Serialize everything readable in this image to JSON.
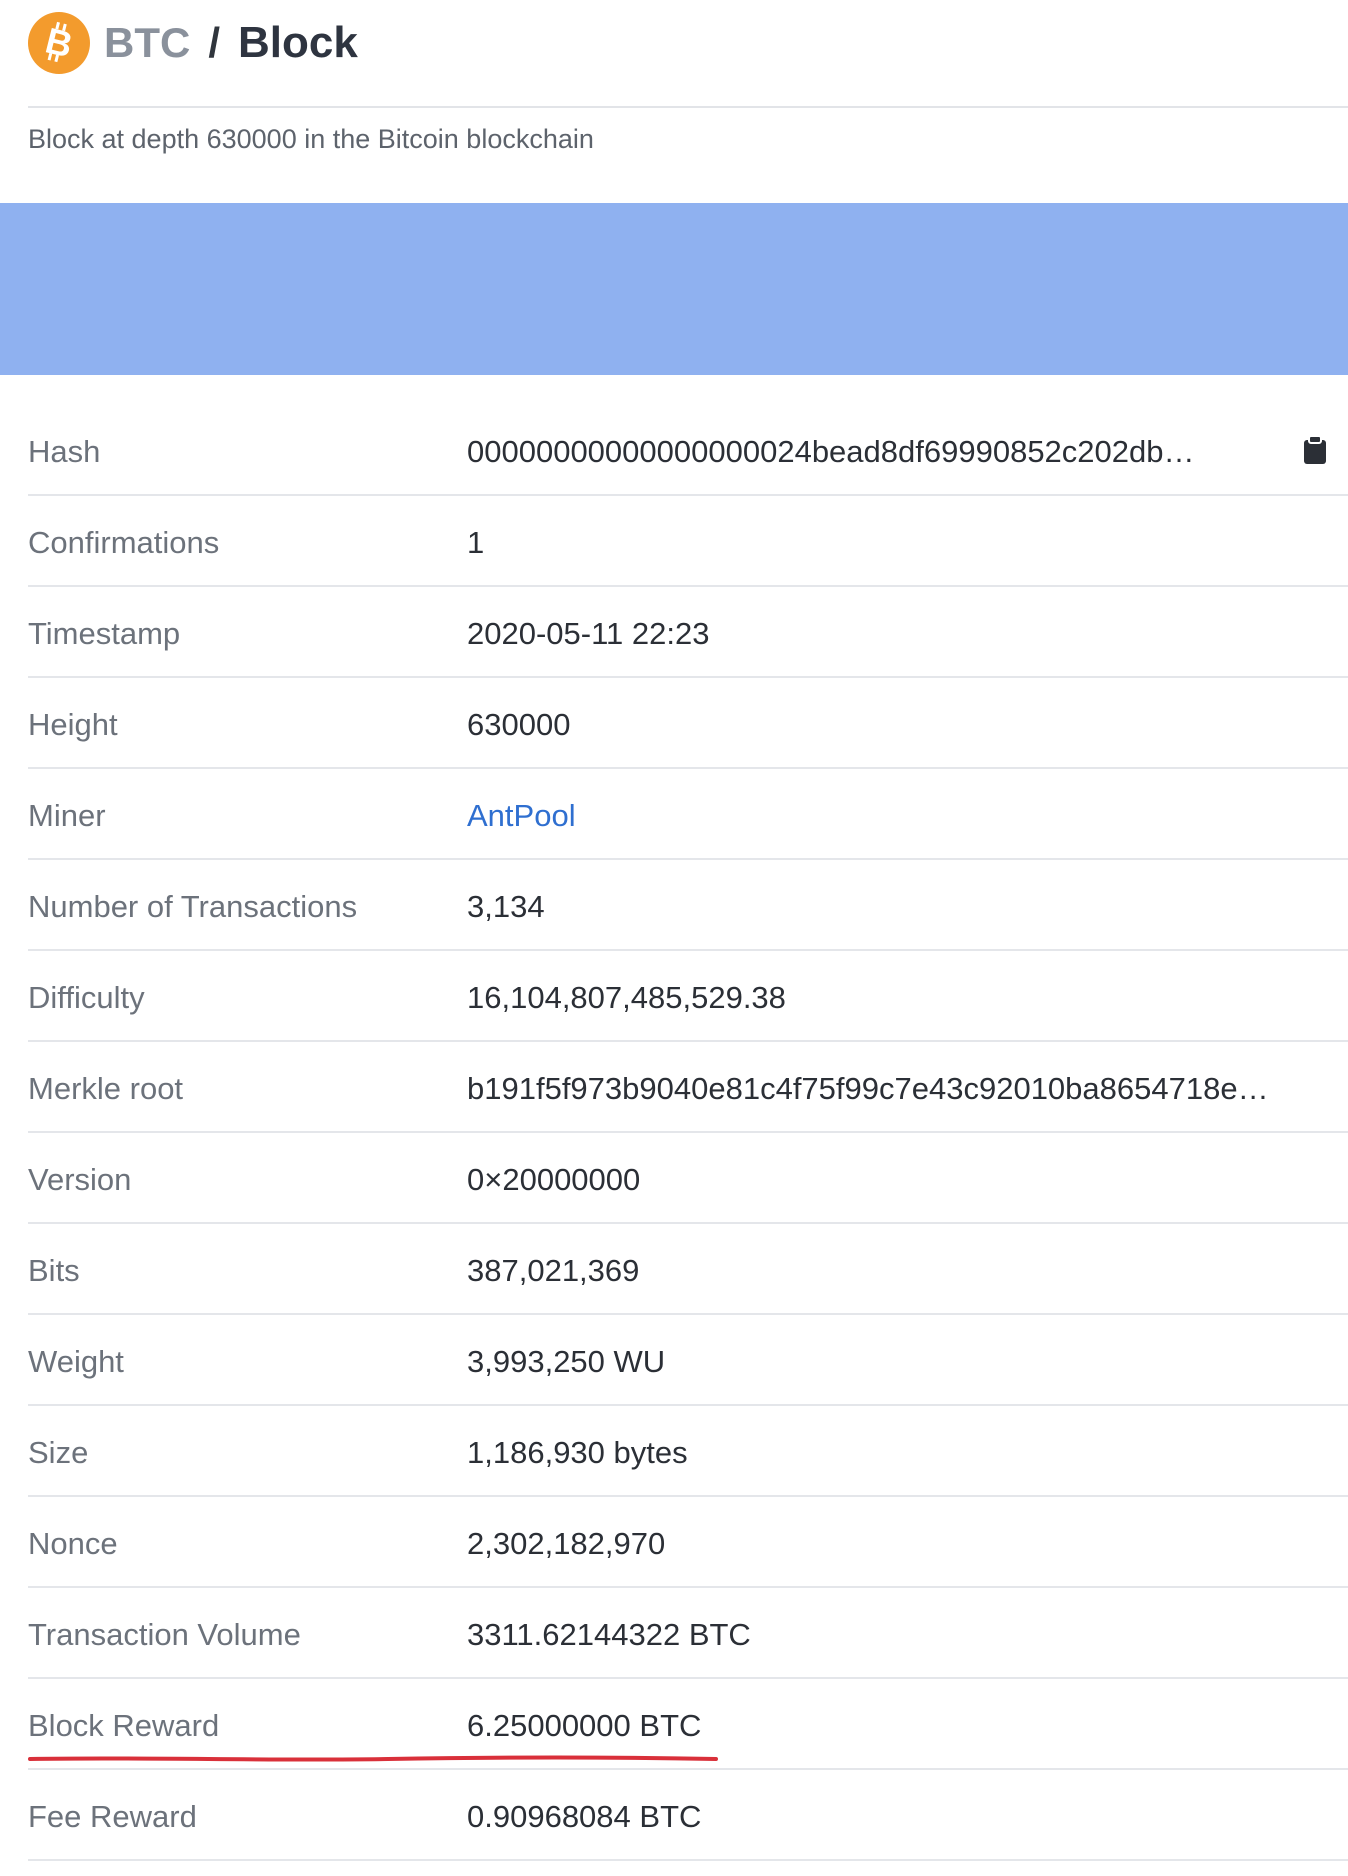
{
  "header": {
    "coin": "BTC",
    "separator": "/",
    "page": "Block",
    "subtitle": "Block at depth 630000 in the Bitcoin blockchain",
    "logo_color": "#f39b2d"
  },
  "banner": {
    "color": "#8fb1f0"
  },
  "details": [
    {
      "label": "Hash",
      "value": "00000000000000000024bead8df69990852c202db…"
    },
    {
      "label": "Confirmations",
      "value": "1"
    },
    {
      "label": "Timestamp",
      "value": "2020-05-11 22:23"
    },
    {
      "label": "Height",
      "value": "630000"
    },
    {
      "label": "Miner",
      "value": "AntPool"
    },
    {
      "label": "Number of Transactions",
      "value": "3,134"
    },
    {
      "label": "Difficulty",
      "value": "16,104,807,485,529.38"
    },
    {
      "label": "Merkle root",
      "value": "b191f5f973b9040e81c4f75f99c7e43c92010ba8654718e…"
    },
    {
      "label": "Version",
      "value": "0×20000000"
    },
    {
      "label": "Bits",
      "value": "387,021,369"
    },
    {
      "label": "Weight",
      "value": "3,993,250 WU"
    },
    {
      "label": "Size",
      "value": "1,186,930 bytes"
    },
    {
      "label": "Nonce",
      "value": "2,302,182,970"
    },
    {
      "label": "Transaction Volume",
      "value": "3311.62144322 BTC"
    },
    {
      "label": "Block Reward",
      "value": "6.25000000 BTC"
    },
    {
      "label": "Fee Reward",
      "value": "0.90968084 BTC"
    }
  ],
  "icons": {
    "logo": "bitcoin-icon",
    "copy": "clipboard-icon"
  },
  "colors": {
    "link": "#2f6fd0",
    "underline_annotation": "#d9303a"
  }
}
